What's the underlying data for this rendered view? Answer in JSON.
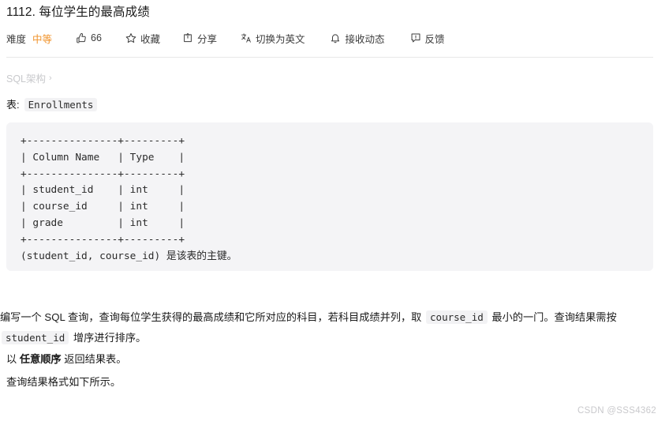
{
  "problem": {
    "title": "1112. 每位学生的最高成绩"
  },
  "toolbar": {
    "difficulty_label": "难度",
    "difficulty_value": "中等",
    "difficulty_color": "#f0932b",
    "like": {
      "icon": "thumbs-up-icon",
      "count": "66"
    },
    "favorite": {
      "icon": "star-icon",
      "label": "收藏"
    },
    "share": {
      "icon": "share-icon",
      "label": "分享"
    },
    "translate": {
      "icon": "translate-icon",
      "label": "切换为英文"
    },
    "subscribe": {
      "icon": "bell-icon",
      "label": "接收动态"
    },
    "feedback": {
      "icon": "feedback-icon",
      "label": "反馈"
    }
  },
  "breadcrumb": {
    "label": "SQL架构",
    "chevron": "›"
  },
  "schema": {
    "table_label": "表:",
    "table_name": "Enrollments",
    "ascii_table": "+---------------+---------+\n| Column Name   | Type    |\n+---------------+---------+\n| student_id    | int     |\n| course_id     | int     |\n| grade         | int     |\n+---------------+---------+\n(student_id, course_id) 是该表的主键。"
  },
  "description": {
    "main_part1": "编写一个 SQL 查询，查询每位学生获得的最高成绩和它所对应的科目，若科目成绩并列，取 ",
    "main_code1": "course_id",
    "main_part2": " 最小的一门。查询结果需按 ",
    "main_code2": "student_id",
    "main_part3": " 增序进行排序。",
    "order_prefix": "以 ",
    "order_bold": "任意顺序",
    "order_suffix": " 返回结果表。",
    "format_note": "查询结果格式如下所示。"
  },
  "watermark": {
    "text": "CSDN @SSS4362"
  }
}
